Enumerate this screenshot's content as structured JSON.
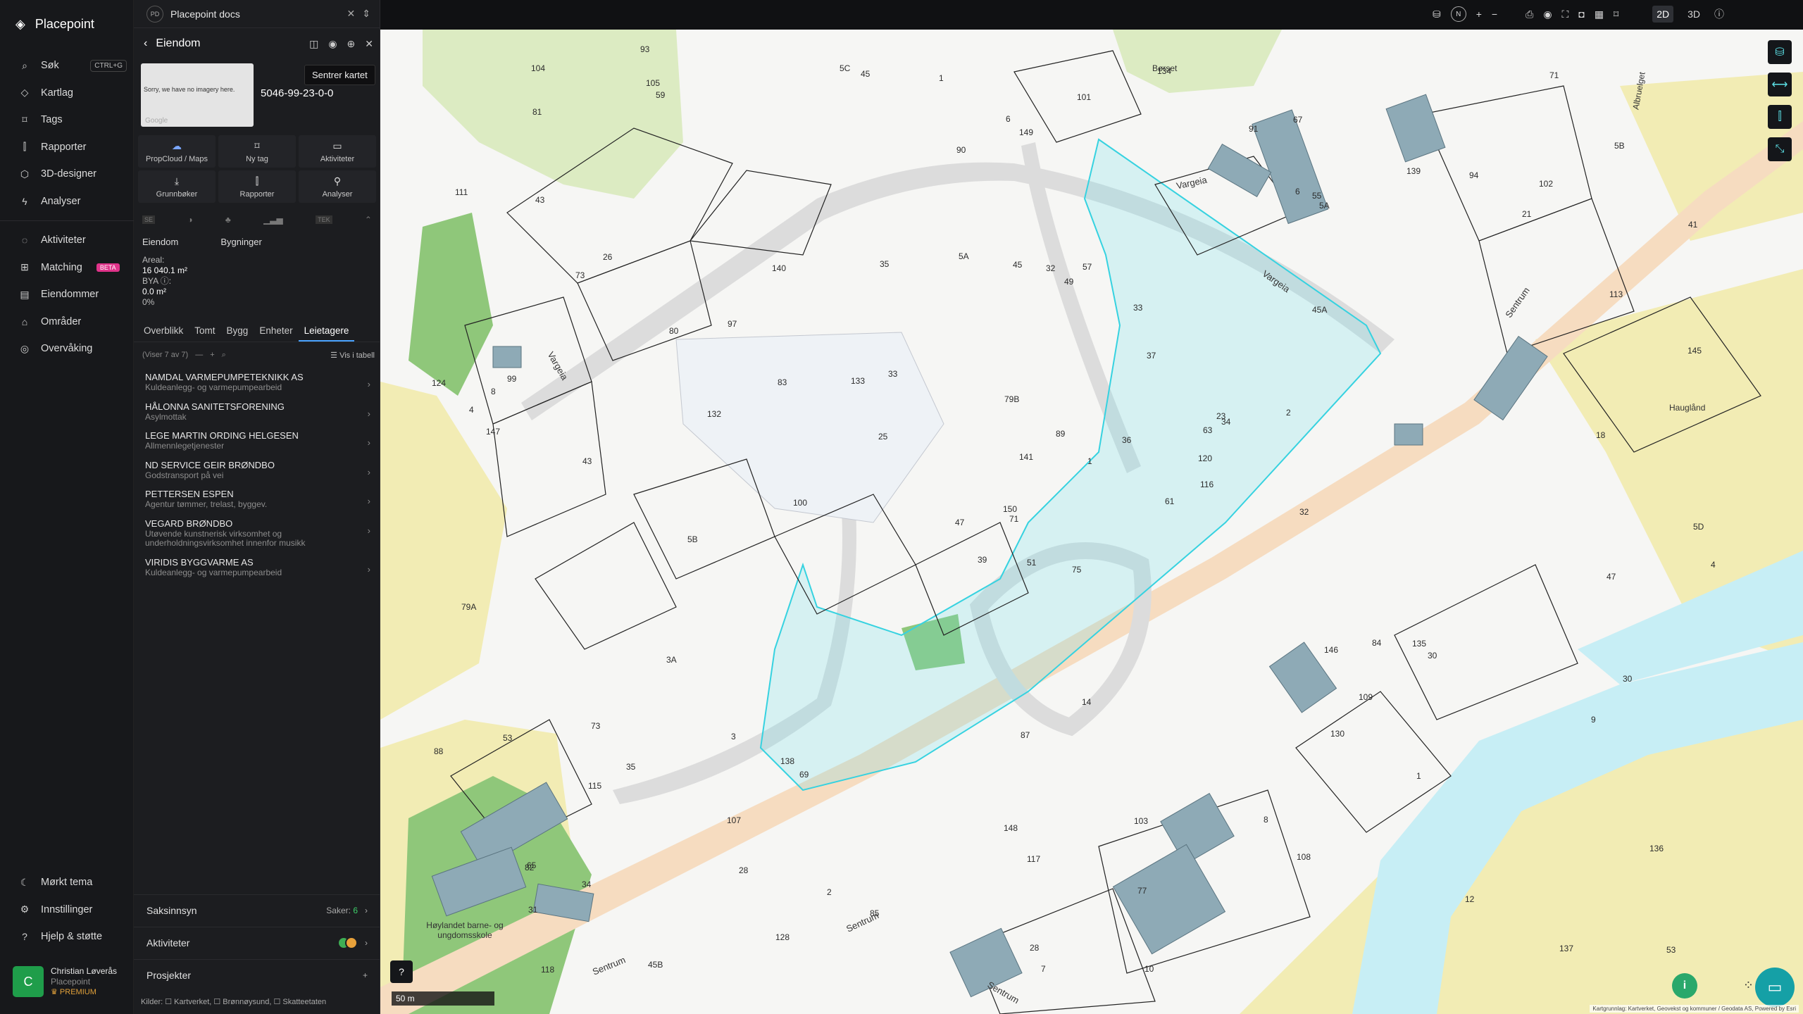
{
  "app": {
    "name": "Placepoint"
  },
  "nav": {
    "search": {
      "label": "Søk",
      "shortcut": "CTRL+G"
    },
    "items": [
      "Kartlag",
      "Tags",
      "Rapporter",
      "3D-designer",
      "Analyser"
    ],
    "items2": [
      {
        "label": "Aktiviteter"
      },
      {
        "label": "Matching",
        "badge": "BETA"
      },
      {
        "label": "Eiendommer"
      },
      {
        "label": "Områder"
      },
      {
        "label": "Overvåking"
      }
    ],
    "bottom": [
      "Mørkt tema",
      "Innstillinger",
      "Hjelp & støtte"
    ],
    "user": {
      "initial": "C",
      "name": "Christian Løverås",
      "org": "Placepoint",
      "plan": "PREMIUM"
    }
  },
  "panel": {
    "tab_icon": "PD",
    "tab_title": "Placepoint docs",
    "header": "Eiendom",
    "tooltip": "Sentrer kartet",
    "no_imagery": "Sorry, we have no imagery here.",
    "google": "Google",
    "property_id": "5046-99-23-0-0",
    "actions": [
      "PropCloud / Maps",
      "Ny tag",
      "Aktiviteter",
      "Grunnbøker",
      "Rapporter",
      "Analyser"
    ],
    "strip": [
      "SE",
      "TEK"
    ],
    "subtabs": [
      "Eiendom",
      "Bygninger"
    ],
    "area_label": "Areal:",
    "area_value": "16 040.1 m²",
    "bya_label": "BYA ⓘ:",
    "bya_value": "0.0 m²",
    "bya_pct": "0%",
    "tabs": [
      "Overblikk",
      "Tomt",
      "Bygg",
      "Enheter",
      "Leietagere"
    ],
    "active_tab": "Leietagere",
    "list_count": "(Viser 7 av 7)",
    "list_table": "Vis i tabell",
    "tenants": [
      {
        "name": "NAMDAL VARMEPUMPETEKNIKK AS",
        "desc": "Kuldeanlegg- og varmepumpearbeid"
      },
      {
        "name": "HÅLONNA SANITETSFORENING",
        "desc": "Asylmottak"
      },
      {
        "name": "LEGE MARTIN ORDING HELGESEN",
        "desc": "Allmennlegetjenester"
      },
      {
        "name": "ND SERVICE Geir Brøndbo",
        "desc": "Godstransport på vei"
      },
      {
        "name": "PETTERSEN ESPEN",
        "desc": "Agentur tømmer, trelast, byggev."
      },
      {
        "name": "VEGARD BRØNDBO",
        "desc": "Utøvende kunstnerisk virksomhet og underholdningsvirksomhet innenfor musikk"
      },
      {
        "name": "VIRIDIS BYGGVARME AS",
        "desc": "Kuldeanlegg- og varmepumpearbeid"
      }
    ],
    "saksinnsyn": {
      "label": "Saksinnsyn",
      "cases_label": "Saker:",
      "cases": "6"
    },
    "aktiviteter": "Aktiviteter",
    "prosjekter": "Prosjekter",
    "sources": "Kilder: ☐ Kartverket, ☐ Brønnøysund, ☐ Skatteetaten"
  },
  "topbar": {
    "compass": "N",
    "view_2d": "2D",
    "view_3d": "3D",
    "active_view": "2D"
  },
  "map": {
    "scale": "50 m",
    "attribution": "Kartgrunnlag: Kartverket, Geovekst og kommuner / Geodata AS, Powered by Esri",
    "streets": [
      "Vargeia",
      "Vargeia",
      "Vargeia",
      "Sentrum",
      "Sentrum",
      "Sentrum",
      "Sentrum",
      "Albruelget"
    ],
    "places": [
      "Børset",
      "Hauglånd",
      "Høylandet barne- og ungdomsskole"
    ],
    "parcels": [
      "75",
      "73",
      "71",
      "65",
      "63",
      "69",
      "67",
      "57",
      "55",
      "61",
      "59",
      "53",
      "43",
      "41",
      "39",
      "45A",
      "45B",
      "45",
      "37",
      "35",
      "33",
      "31",
      "28",
      "32",
      "34",
      "30",
      "26",
      "149",
      "147",
      "146",
      "145",
      "150",
      "148",
      "141",
      "140",
      "139",
      "138",
      "137",
      "136",
      "135",
      "134",
      "133",
      "132",
      "130",
      "128",
      "124",
      "120",
      "118",
      "117",
      "116",
      "115",
      "113",
      "111",
      "109",
      "108",
      "107",
      "105",
      "104",
      "103",
      "102",
      "101",
      "100",
      "99",
      "97",
      "94",
      "93",
      "91",
      "90",
      "89",
      "88",
      "87",
      "85",
      "84",
      "83",
      "82",
      "81",
      "80",
      "79A",
      "79B",
      "77",
      "36",
      "34",
      "32",
      "30",
      "28",
      "18",
      "14",
      "12",
      "10",
      "8",
      "6",
      "4",
      "2",
      "1",
      "1",
      "9",
      "8",
      "7",
      "6",
      "5A",
      "5B",
      "5C",
      "5D",
      "4",
      "3A",
      "3",
      "2",
      "23",
      "21",
      "25",
      "47",
      "43",
      "49",
      "47",
      "45",
      "53",
      "51",
      "5B",
      "5A",
      "1",
      "73",
      "71",
      "33",
      "35"
    ]
  }
}
